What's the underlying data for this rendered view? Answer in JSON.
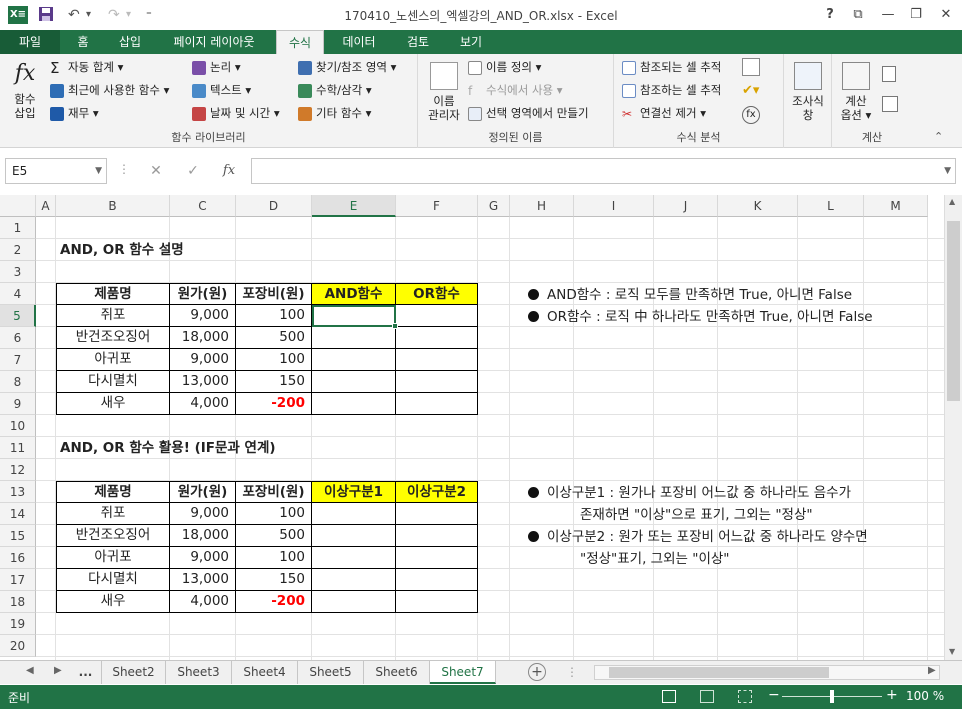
{
  "window": {
    "title": "170410_노센스의_엑셀강의_AND_OR.xlsx - Excel",
    "help": "?",
    "ribbon_display": "⧉",
    "minimize": "—",
    "restore": "❐",
    "close": "✕"
  },
  "qat": {
    "undo": "↶",
    "undo_more": "▾",
    "redo": "↷",
    "redo_more": "▾",
    "customize": "₹"
  },
  "tabs": [
    "파일",
    "홈",
    "삽입",
    "페이지 레이아웃",
    "수식",
    "데이터",
    "검토",
    "보기"
  ],
  "ribbon": {
    "insert_function": "함수\n삽입",
    "autosum": "자동 합계 ▾",
    "recent": "최근에 사용한 함수 ▾",
    "financial": "재무 ▾",
    "logical": "논리 ▾",
    "text": "텍스트 ▾",
    "datetime": "날짜 및 시간 ▾",
    "lookup": "찾기/참조 영역 ▾",
    "math": "수학/삼각 ▾",
    "more": "기타 함수 ▾",
    "group_library": "함수 라이브러리",
    "name_manager": "이름\n관리자",
    "define_name": "이름 정의 ▾",
    "use_in_formula": "수식에서 사용 ▾",
    "create_from_selection": "선택 영역에서 만들기",
    "group_names": "정의된 이름",
    "trace_precedents": "참조되는 셀 추적",
    "trace_dependents": "참조하는 셀 추적",
    "remove_arrows": "연결선 제거 ▾",
    "group_audit": "수식 분석",
    "watch": "조사식\n창",
    "calc_options": "계산\n옵션 ▾",
    "group_calc": "계산"
  },
  "formula_bar": {
    "name_box": "E5",
    "cancel": "✕",
    "enter": "✓",
    "fx": "fx",
    "value": ""
  },
  "columns": [
    "A",
    "B",
    "C",
    "D",
    "E",
    "F",
    "G",
    "H",
    "I",
    "J",
    "K",
    "L",
    "M"
  ],
  "rows": [
    "1",
    "2",
    "3",
    "4",
    "5",
    "6",
    "7",
    "8",
    "9",
    "10",
    "11",
    "12",
    "13",
    "14",
    "15",
    "16",
    "17",
    "18",
    "19",
    "20"
  ],
  "sheet": {
    "title1": "AND, OR 함수 설명",
    "title2": "AND, OR 함수 활용! (IF문과 연계)",
    "table1": {
      "headers": [
        "제품명",
        "원가(원)",
        "포장비(원)",
        "AND함수",
        "OR함수"
      ],
      "rows": [
        [
          "쥐포",
          "9,000",
          "100",
          "",
          ""
        ],
        [
          "반건조오징어",
          "18,000",
          "500",
          "",
          ""
        ],
        [
          "아귀포",
          "9,000",
          "100",
          "",
          ""
        ],
        [
          "다시멸치",
          "13,000",
          "150",
          "",
          ""
        ],
        [
          "새우",
          "4,000",
          "-200",
          "",
          ""
        ]
      ]
    },
    "table2": {
      "headers": [
        "제품명",
        "원가(원)",
        "포장비(원)",
        "이상구분1",
        "이상구분2"
      ],
      "rows": [
        [
          "쥐포",
          "9,000",
          "100",
          "",
          ""
        ],
        [
          "반건조오징어",
          "18,000",
          "500",
          "",
          ""
        ],
        [
          "아귀포",
          "9,000",
          "100",
          "",
          ""
        ],
        [
          "다시멸치",
          "13,000",
          "150",
          "",
          ""
        ],
        [
          "새우",
          "4,000",
          "-200",
          "",
          ""
        ]
      ]
    },
    "notes1": [
      "AND함수 : 로직 모두를 만족하면 True, 아니면 False",
      "OR함수 : 로직 中 하나라도 만족하면 True, 아니면 False"
    ],
    "notes2": [
      {
        "line1": "이상구분1 : 원가나 포장비 어느값 중 하나라도 음수가",
        "line2": "존재하면 \"이상\"으로 표기, 그외는 \"정상\""
      },
      {
        "line1": "이상구분2 : 원가 또는 포장비 어느값 중 하나라도 양수면",
        "line2": "\"정상\"표기, 그외는 \"이상\""
      }
    ]
  },
  "sheet_tabs": [
    "...",
    "Sheet2",
    "Sheet3",
    "Sheet4",
    "Sheet5",
    "Sheet6",
    "Sheet7"
  ],
  "active_sheet": "Sheet7",
  "status": {
    "ready": "준비",
    "zoom": "100 %",
    "minus": "−",
    "plus": "+"
  },
  "colors": {
    "accent": "#217346",
    "highlight": "#ffff00",
    "negative": "#ff0000"
  }
}
